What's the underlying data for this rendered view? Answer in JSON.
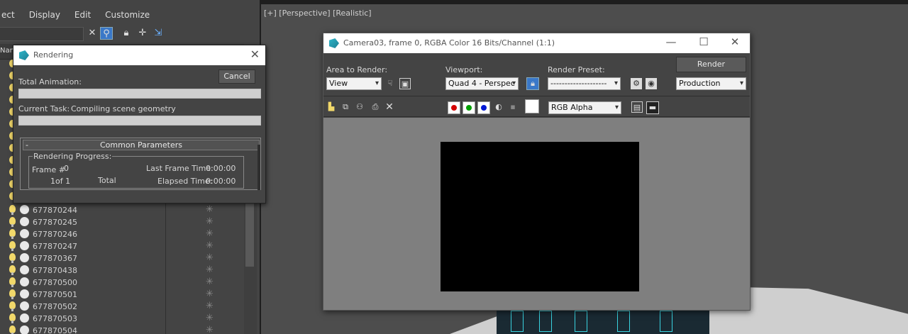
{
  "menubar": {
    "items": [
      "ect",
      "Display",
      "Edit",
      "Customize"
    ]
  },
  "explorer": {
    "column_header": "Nam",
    "rows": [
      {
        "name": "677870244"
      },
      {
        "name": "677870245"
      },
      {
        "name": "677870246"
      },
      {
        "name": "677870247"
      },
      {
        "name": "677870367"
      },
      {
        "name": "677870438"
      },
      {
        "name": "677870500"
      },
      {
        "name": "677870501"
      },
      {
        "name": "677870502"
      },
      {
        "name": "677870503"
      },
      {
        "name": "677870504"
      }
    ]
  },
  "viewport": {
    "label": "[+] [Perspective] [Realistic]"
  },
  "rendering_dialog": {
    "title": "Rendering",
    "cancel_label": "Cancel",
    "total_animation_label": "Total Animation:",
    "current_task_label": "Current Task:",
    "current_task_value": "Compiling scene geometry",
    "common_parameters_label": "Common Parameters",
    "collapse_glyph": "-",
    "rendering_progress_label": "Rendering Progress:",
    "frame_label": "Frame #",
    "frame_value": "0",
    "frame_count": "1of 1",
    "total_label": "Total",
    "last_frame_time_label": "Last Frame Time:",
    "last_frame_time_value": "0:00:00",
    "elapsed_time_label": "Elapsed Time:",
    "elapsed_time_value": "0:00:00",
    "total_animation_progress": 0.0
  },
  "render_window": {
    "title": "Camera03, frame 0, RGBA Color 16 Bits/Channel (1:1)",
    "area_to_render_label": "Area to Render:",
    "area_to_render_value": "View",
    "viewport_label": "Viewport:",
    "viewport_value": "Quad 4 - Perspec",
    "render_preset_label": "Render Preset:",
    "render_preset_value": "--------------------",
    "render_button_label": "Render",
    "production_value": "Production",
    "channel_value": "RGB Alpha",
    "colors": {
      "red": "#d40000",
      "green": "#00a000",
      "blue": "#0018d4",
      "swatch": "#ffffff"
    }
  }
}
